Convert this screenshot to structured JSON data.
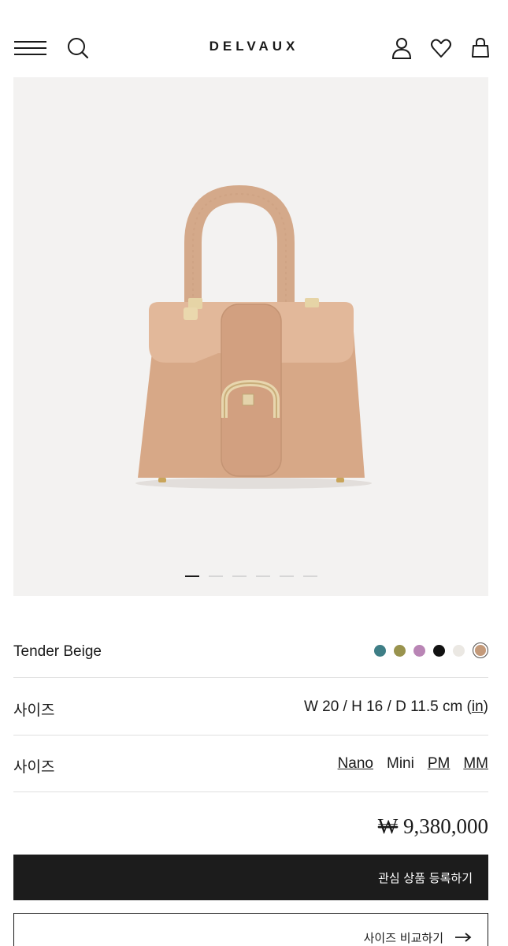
{
  "header": {
    "brand": "DELVAUX",
    "icons": [
      "menu-icon",
      "search-icon",
      "account-icon",
      "heart-icon",
      "bag-icon"
    ]
  },
  "gallery": {
    "slide_count": 6,
    "active_slide": 1
  },
  "product": {
    "color_name": "Tender Beige",
    "swatches": [
      {
        "color": "#3e7e86"
      },
      {
        "color": "#99934e"
      },
      {
        "color": "#b985b5"
      },
      {
        "color": "#111111"
      },
      {
        "color": "#ebe8e3"
      },
      {
        "color": "#c49a7a",
        "selected": true
      }
    ],
    "dimensions_label": "사이즈",
    "dimensions_value": "W 20 / H 16 / D 11.5 cm",
    "dimensions_unit_link": "in",
    "size_label": "사이즈",
    "sizes": [
      {
        "label": "Nano",
        "link": true
      },
      {
        "label": "Mini",
        "link": false
      },
      {
        "label": "PM",
        "link": true
      },
      {
        "label": "MM",
        "link": true
      }
    ],
    "currency_symbol": "₩",
    "price": "9,380,000"
  },
  "actions": {
    "wishlist_label": "관심 상품 등록하기",
    "compare_label": "사이즈 비교하기"
  }
}
